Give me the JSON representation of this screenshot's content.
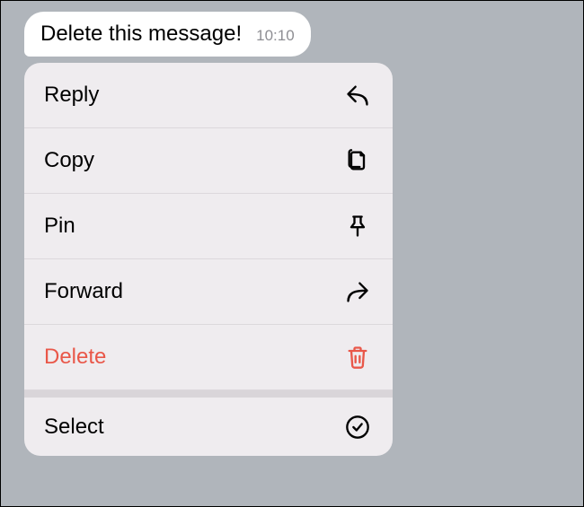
{
  "message": {
    "text": "Delete this message!",
    "time": "10:10"
  },
  "menu": {
    "items": [
      {
        "label": "Reply",
        "icon": "reply-icon",
        "destructive": false
      },
      {
        "label": "Copy",
        "icon": "copy-icon",
        "destructive": false
      },
      {
        "label": "Pin",
        "icon": "pin-icon",
        "destructive": false
      },
      {
        "label": "Forward",
        "icon": "forward-icon",
        "destructive": false
      },
      {
        "label": "Delete",
        "icon": "trash-icon",
        "destructive": true
      }
    ],
    "separated": [
      {
        "label": "Select",
        "icon": "select-icon",
        "destructive": false
      }
    ]
  },
  "colors": {
    "background": "#b0b5bb",
    "bubble": "#ffffff",
    "menu": "#efecef",
    "destructive": "#e95749"
  }
}
